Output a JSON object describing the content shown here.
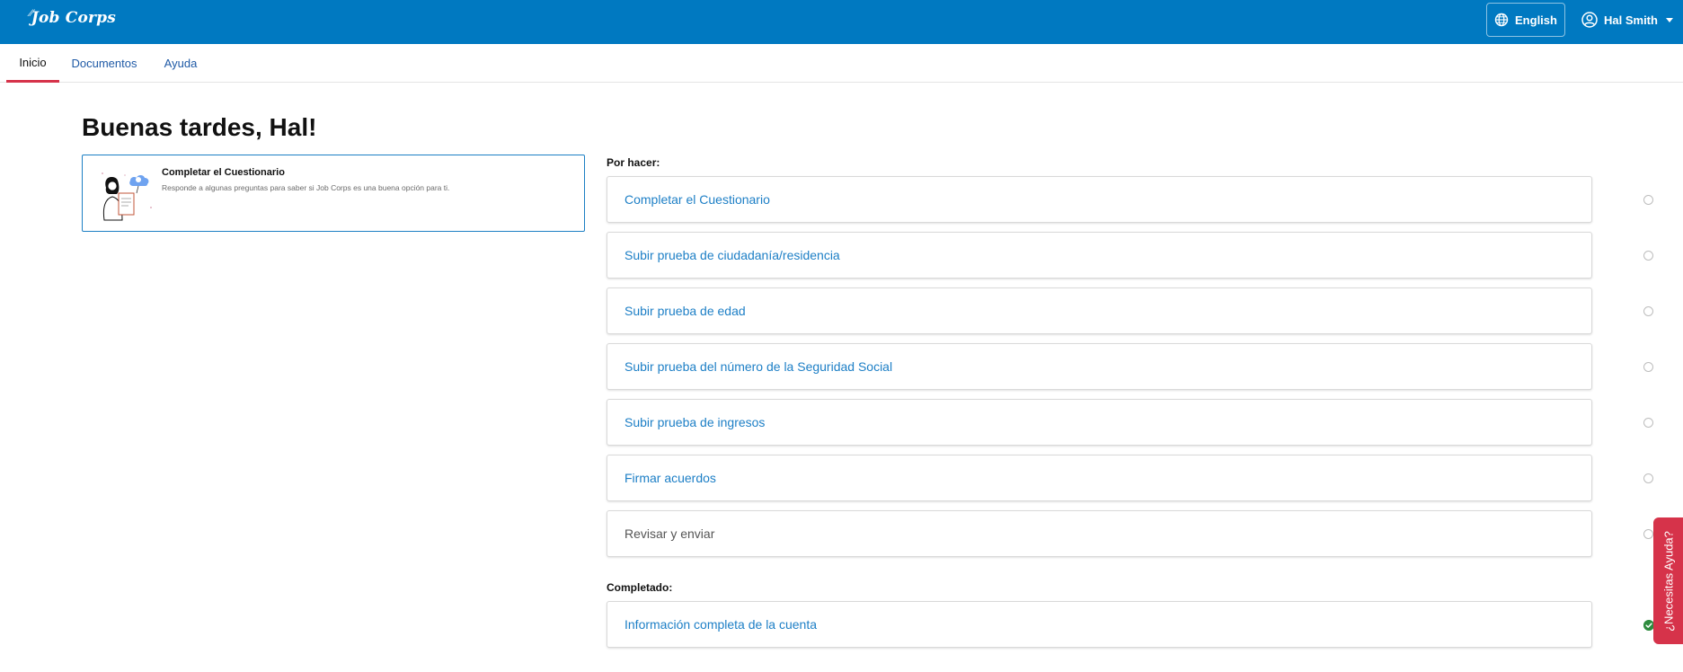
{
  "header": {
    "logo_text": "Job Corps",
    "language_label": "English",
    "user_name": "Hal Smith"
  },
  "nav": {
    "tabs": [
      {
        "label": "Inicio",
        "active": true
      },
      {
        "label": "Documentos",
        "active": false
      },
      {
        "label": "Ayuda",
        "active": false
      }
    ]
  },
  "main": {
    "greeting": "Buenas tardes, Hal!",
    "questionnaire_card": {
      "title": "Completar el Cuestionario",
      "description": "Responde a algunas preguntas para saber si Job Corps es una buena opción para ti."
    },
    "todo_label": "Por hacer:",
    "todo_items": [
      {
        "label": "Completar el Cuestionario",
        "status": "pending"
      },
      {
        "label": "Subir prueba de ciudadanía/residencia",
        "status": "pending"
      },
      {
        "label": "Subir prueba de edad",
        "status": "pending"
      },
      {
        "label": "Subir prueba del número de la Seguridad Social",
        "status": "pending"
      },
      {
        "label": "Subir prueba de ingresos",
        "status": "pending"
      },
      {
        "label": "Firmar acuerdos",
        "status": "pending"
      },
      {
        "label": "Revisar y enviar",
        "status": "pending"
      }
    ],
    "completed_label": "Completado:",
    "completed_items": [
      {
        "label": "Información completa de la cuenta",
        "status": "complete"
      }
    ]
  },
  "help_tab": {
    "label": "¿Necesitas Ayuda?"
  },
  "colors": {
    "brand_blue": "#0079c1",
    "accent_red": "#d6334a",
    "link_blue": "#1d7fc6",
    "success_green": "#2e8b3e"
  },
  "icons": [
    "globe-icon",
    "user-circle-icon",
    "chevron-down-icon",
    "empty-circle-icon",
    "check-circle-icon"
  ]
}
